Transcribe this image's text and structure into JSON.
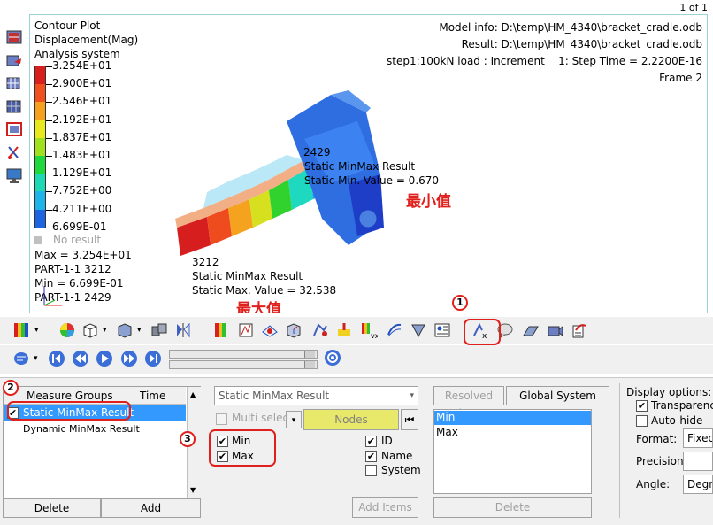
{
  "page_indicator": "1 of 1",
  "viewport": {
    "title_lines": [
      "Contour Plot",
      "Displacement(Mag)",
      "Analysis system"
    ],
    "model_info": "Model info: D:\\temp\\HM_4340\\bracket_cradle.odb",
    "result": "Result: D:\\temp\\HM_4340\\bracket_cradle.odb",
    "step": "step1:100kN load : Increment",
    "step_time": "1: Step Time =   2.2200E-16",
    "frame": "Frame 2",
    "legend_values": [
      "3.254E+01",
      "2.900E+01",
      "2.546E+01",
      "2.192E+01",
      "1.837E+01",
      "1.483E+01",
      "1.129E+01",
      "7.752E+00",
      "4.211E+00",
      "6.699E-01"
    ],
    "legend_colors": [
      "#d91e1e",
      "#f0501e",
      "#f5a01e",
      "#e8e81e",
      "#a0e01e",
      "#1ed83c",
      "#1ed8b4",
      "#1eb4e8",
      "#1e64e0",
      "#1e28b4"
    ],
    "no_result": "No result",
    "max_line": "Max = 3.254E+01",
    "max_part": "PART-1-1 3212",
    "min_line": "Min = 6.699E-01",
    "min_part": "PART-1-1 2429",
    "min_node_id": "2429",
    "min_result_label": "Static MinMax Result",
    "min_value": "Static Min. Value = 0.670",
    "min_annot_cn": "最小值",
    "max_node_id": "3212",
    "max_result_label": "Static MinMax Result",
    "max_value": "Static Max. Value = 32.538",
    "max_annot_cn": "最大值"
  },
  "callouts": [
    "1",
    "2",
    "3"
  ],
  "panel": {
    "measure_groups_header": "Measure Groups",
    "time_header": "Time",
    "groups": [
      "Static MinMax Result",
      "Dynamic MinMax Result"
    ],
    "delete_label": "Delete",
    "add_label": "Add",
    "result_dropdown": "Static MinMax Result",
    "multi_select": "Multi select",
    "nodes_label": "Nodes",
    "min_label": "Min",
    "max_label": "Max",
    "id_label": "ID",
    "name_label": "Name",
    "system_label": "System",
    "add_items_label": "Add Items",
    "resolved_in": "Resolved in...",
    "global_system": "Global System",
    "minmax_list": [
      "Min",
      "Max"
    ],
    "delete2_label": "Delete",
    "display_options": "Display options:",
    "transparency": "Transparency",
    "auto_hide": "Auto-hide",
    "format_label": "Format:",
    "format_value": "Fixed",
    "precision_label": "Precision:",
    "angle_label": "Angle:",
    "angle_value": "Degre"
  }
}
